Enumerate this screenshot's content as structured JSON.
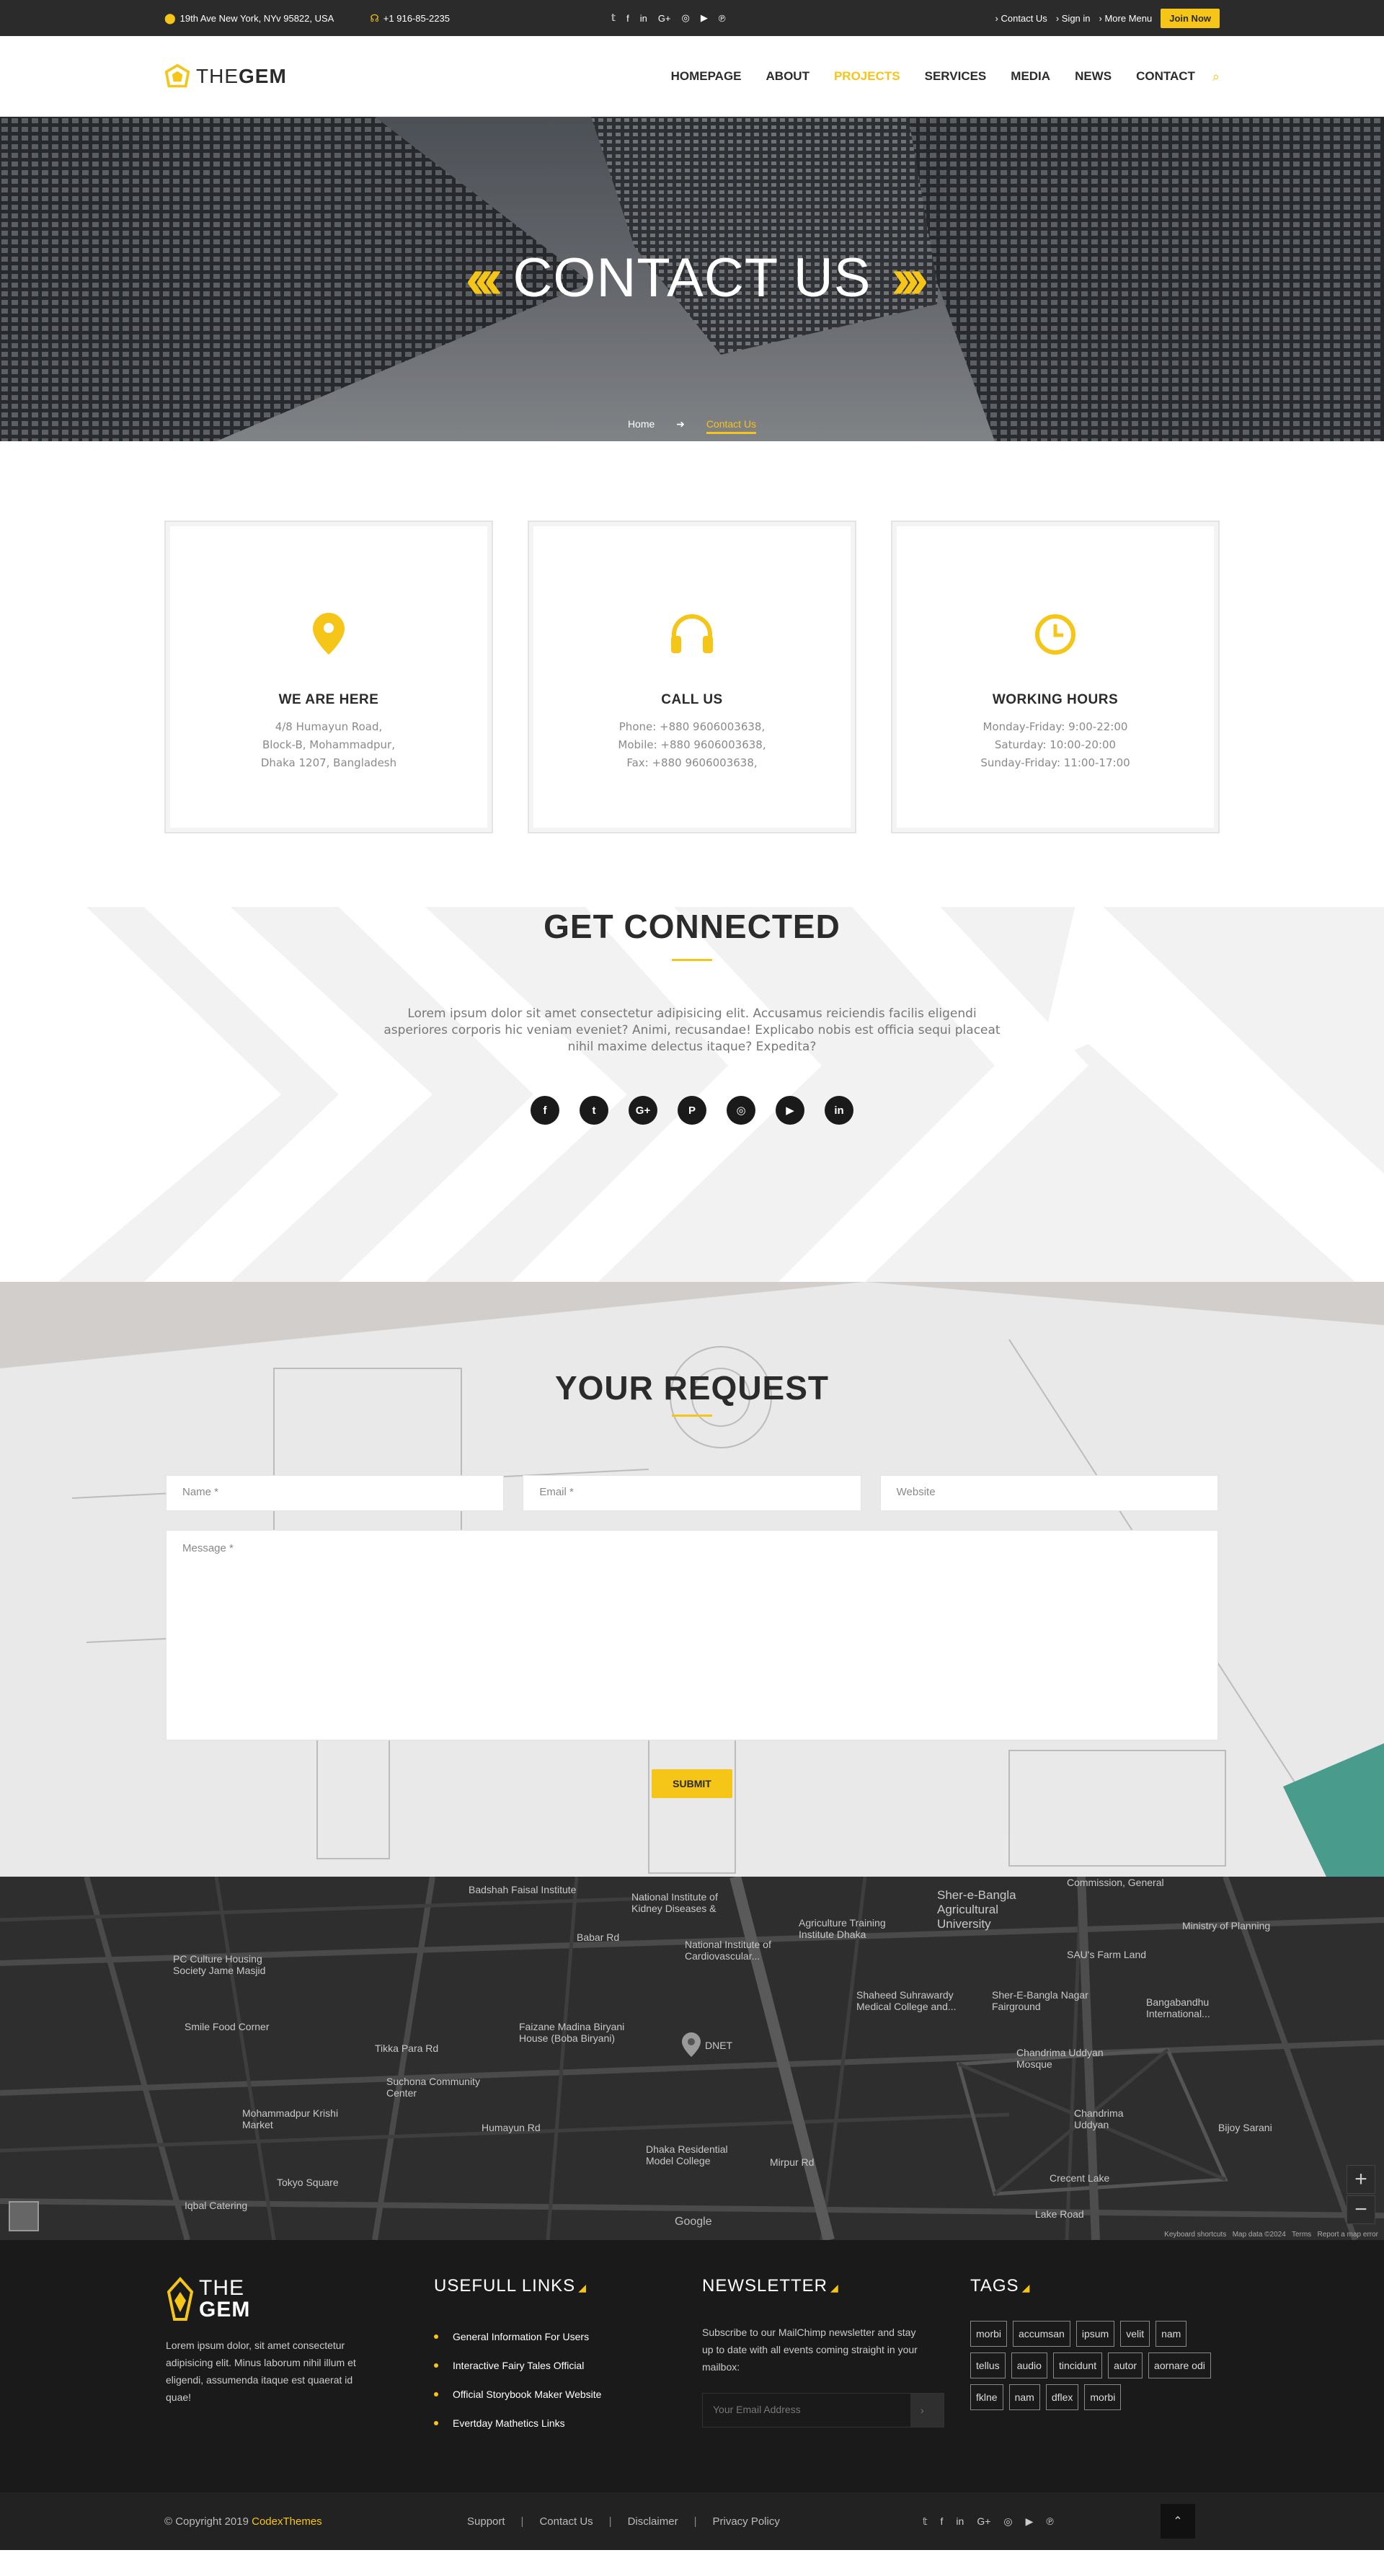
{
  "topbar": {
    "address": "19th Ave New York, NYv 95822, USA",
    "phone": "+1 916-85-2235",
    "social": [
      "twitter",
      "facebook",
      "linkedin",
      "google-plus",
      "instagram",
      "youtube",
      "pinterest"
    ],
    "links": [
      "Contact Us",
      "Sign in",
      "More Menu"
    ],
    "join_label": "Join Now"
  },
  "header": {
    "logo_prefix": "THE",
    "logo_suffix": "GEM",
    "nav": [
      {
        "label": "HOMEPAGE"
      },
      {
        "label": "ABOUT"
      },
      {
        "label": "PROJECTS"
      },
      {
        "label": "SERVICES"
      },
      {
        "label": "MEDIA"
      },
      {
        "label": "NEWS"
      },
      {
        "label": "CONTACT"
      }
    ],
    "active_nav": "PROJECTS"
  },
  "hero": {
    "title": "CONTACT US",
    "breadcrumb_home": "Home",
    "breadcrumb_current": "Contact Us"
  },
  "info_cards": [
    {
      "icon": "map-pin-icon",
      "title": "WE ARE HERE",
      "lines": [
        "4/8 Humayun Road,",
        "Block-B, Mohammadpur,",
        "Dhaka 1207, Bangladesh"
      ]
    },
    {
      "icon": "headphones-icon",
      "title": "CALL US",
      "lines": [
        "Phone: +880 9606003638,",
        "Mobile: +880 9606003638,",
        "Fax: +880 9606003638,"
      ]
    },
    {
      "icon": "clock-icon",
      "title": "WORKING HOURS",
      "lines": [
        "Monday-Friday: 9:00-22:00",
        "Saturday: 10:00-20:00",
        "Sunday-Friday: 11:00-17:00"
      ]
    }
  ],
  "connect": {
    "title": "GET CONNECTED",
    "text": "Lorem ipsum dolor sit amet consectetur adipisicing elit. Accusamus reiciendis facilis eligendi asperiores corporis hic veniam eveniet? Animi, recusandae! Explicabo nobis est officia sequi placeat nihil maxime delectus itaque? Expedita?",
    "social": [
      {
        "name": "facebook-icon",
        "glyph": "f"
      },
      {
        "name": "twitter-icon",
        "glyph": "t"
      },
      {
        "name": "google-plus-icon",
        "glyph": "G+"
      },
      {
        "name": "pinterest-icon",
        "glyph": "P"
      },
      {
        "name": "instagram-icon",
        "glyph": "◎"
      },
      {
        "name": "youtube-icon",
        "glyph": "▶"
      },
      {
        "name": "linkedin-icon",
        "glyph": "in"
      }
    ]
  },
  "request": {
    "title": "YOUR REQUEST",
    "name_placeholder": "Name *",
    "email_placeholder": "Email *",
    "website_placeholder": "Website",
    "message_placeholder": "Message *",
    "submit_label": "SUBMIT"
  },
  "map": {
    "labels": [
      "Badshah Faisal Institute",
      "National Institute of Kidney Diseases &",
      "National Institute of Cardiovascular...",
      "Agriculture Training Institute Dhaka",
      "Sher-e-Bangla Agricultural University",
      "Commission, General",
      "Ministry of Planning",
      "PC Culture Housing Society Jame Masjid",
      "Babar Rd",
      "SAU's Farm Land",
      "Shaheed Suhrawardy Medical College and...",
      "Sher-E-Bangla Nagar Fairground",
      "Bangabandhu International...",
      "Smile Food Corner",
      "Faizane Madina Biryani House (Boba Biryani)",
      "DNET",
      "Chandrima Uddyan Mosque",
      "Suchona Community Center",
      "Tikka Para Rd",
      "Mohammadpur Krishi Market",
      "Chandrima Uddyan",
      "Bijoy Sarani",
      "Humayun Rd",
      "Dhaka Residential Model College",
      "Crecent Lake",
      "Tokyo Square",
      "Iqbal Catering",
      "Lake Road",
      "Mirpur Rd",
      "Google"
    ],
    "attribution": [
      "Keyboard shortcuts",
      "Map data ©2024",
      "Terms",
      "Report a map error"
    ],
    "zoom_in": "+",
    "zoom_out": "−"
  },
  "footer": {
    "logo_prefix": "THE",
    "logo_suffix": "GEM",
    "about": "Lorem ipsum dolor, sit amet consectetur adipisicing elit. Minus laborum nihil illum et eligendi, assumenda itaque est quaerat id quae!",
    "links_title": "USEFULL LINKS",
    "links": [
      "General Information For Users",
      "Interactive Fairy Tales Official",
      "Official Storybook Maker Website",
      "Evertday Mathetics Links"
    ],
    "newsletter_title": "NEWSLETTER",
    "newsletter_text": "Subscribe to our MailChimp newsletter and stay up to date with all events coming straight in your mailbox:",
    "newsletter_placeholder": "Your Email Address",
    "tags_title": "TAGS",
    "tags": [
      "morbi",
      "accumsan",
      "ipsum",
      "velit",
      "nam",
      "tellus",
      "audio",
      "tincidunt",
      "autor",
      "aornare odi",
      "fklne",
      "nam",
      "dflex",
      "morbi"
    ]
  },
  "bottom": {
    "copyright": "© Copyright 2019",
    "brand": "CodexThemes",
    "links": [
      "Support",
      "Contact Us",
      "Disclaimer",
      "Privacy Policy"
    ],
    "social": [
      "twitter",
      "facebook",
      "linkedin",
      "google-plus",
      "instagram",
      "youtube",
      "pinterest"
    ]
  },
  "colors": {
    "accent": "#f5c518",
    "dark": "#2b2b2b",
    "footer": "#1a1a1a"
  }
}
